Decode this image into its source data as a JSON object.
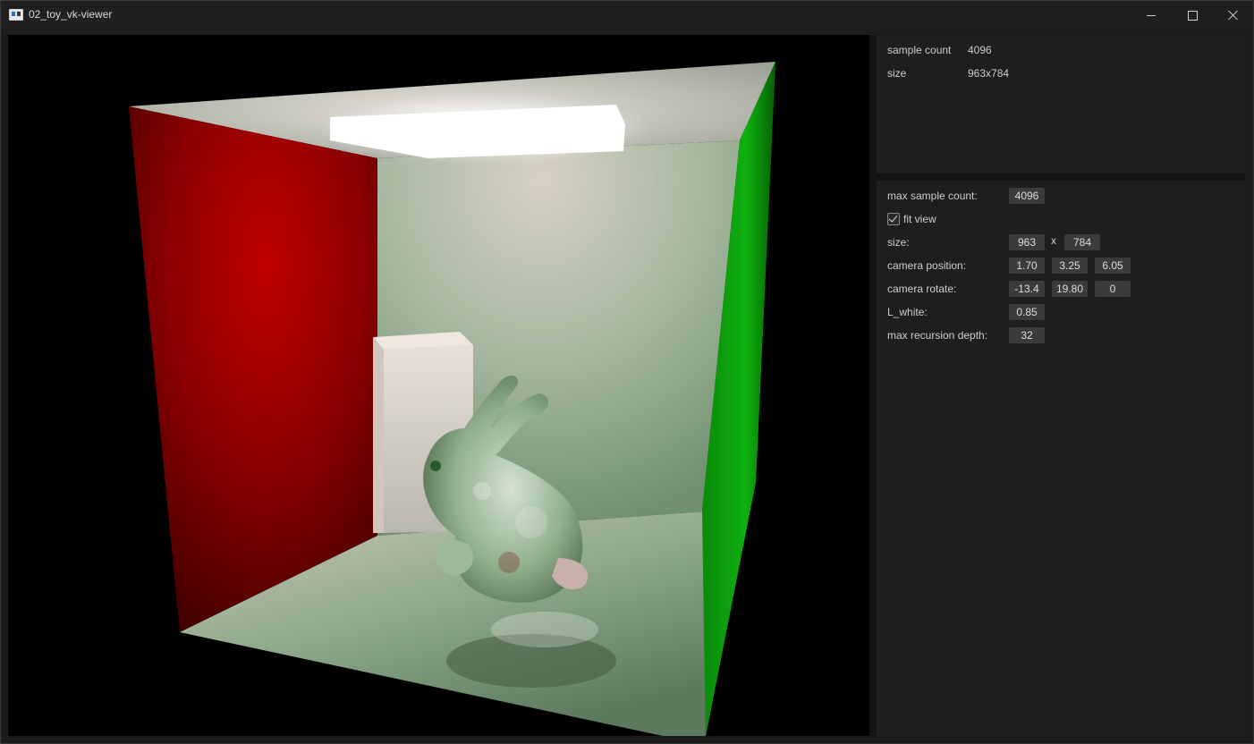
{
  "window": {
    "title": "02_toy_vk-viewer",
    "icon": "app-window-icon",
    "controls": {
      "minimize": "minimize-icon",
      "maximize": "maximize-icon",
      "close": "close-icon"
    }
  },
  "viewport": {
    "description_icon": "rendered-image",
    "scene": "cornell-box-bunny"
  },
  "stats": {
    "sample_count_label": "sample count",
    "sample_count_value": "4096",
    "size_label": "size",
    "size_value": "963x784"
  },
  "settings": {
    "max_sample_count_label": "max sample count:",
    "max_sample_count_value": "4096",
    "fit_view_label": "fit view",
    "fit_view_checked": true,
    "size_label": "size:",
    "size_width": "963",
    "size_separator": "x",
    "size_height": "784",
    "camera_position_label": "camera position:",
    "camera_position": [
      "1.70",
      "3.25",
      "6.05"
    ],
    "camera_rotate_label": "camera rotate:",
    "camera_rotate": [
      "-13.4",
      "19.80",
      "0"
    ],
    "l_white_label": "L_white:",
    "l_white_value": "0.85",
    "max_recursion_depth_label": "max recursion depth:",
    "max_recursion_depth_value": "32"
  },
  "colors": {
    "red_wall": "#b00000",
    "green_wall": "#0a9a0a",
    "back_wall": "#8aa88a",
    "floor": "#7d947d",
    "light": "#ffffff",
    "panel_bg": "#1e1e1e",
    "field_bg": "#3b3b3b"
  }
}
